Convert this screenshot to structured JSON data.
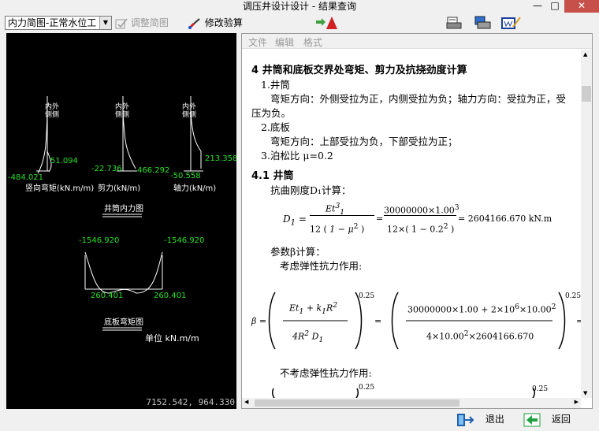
{
  "window": {
    "title": "调压井设计设计 - 结果查询",
    "min": "—",
    "max": "□",
    "close": "✕"
  },
  "toolbar": {
    "combo_value": "内力简图-正常水位工",
    "adjust_label": "调整简图",
    "modify_label": "修改验算"
  },
  "drawing": {
    "lbl_col1": "内外",
    "lbl_col2": "侧侧",
    "n1": "51.094",
    "n2": "-484.021",
    "n3": "-22.736",
    "n4": "466.292",
    "n5": "-50.558",
    "n6": "213.358",
    "cap1": "竖向弯矩(kN.m/m)",
    "cap2": "剪力(kN/m)",
    "cap3": "轴力(kN/m)",
    "title1": "井筒内力图",
    "b1": "-1546.920",
    "b2": "-1546.920",
    "b3": "260.401",
    "b4": "260.401",
    "title2": "底板弯矩图",
    "unit": "单位 kN.m/m",
    "coords": "7152.542, 964.330"
  },
  "menu": {
    "file": "文件",
    "edit": "编辑",
    "format": "格式"
  },
  "doc": {
    "h4": "4  井筒和底板交界处弯矩、剪力及抗挠劲度计算",
    "i1": "1.井筒",
    "i1a": "弯矩方向：外侧受拉为正，内侧受拉为负；轴力方向：受拉为正，受",
    "i1b": "压为负。",
    "i2": "2.底板",
    "i2a": "弯矩方向：上部受拉为负，下部受拉为正；",
    "i3": "3.泊松比  μ=0.2",
    "h41": "4.1  井筒",
    "stiff": "抗曲刚度D₁计算：",
    "f1": "D",
    "f1sub": "1",
    "f1eq": "=",
    "f1num": "Et",
    "f1num_sup": "3",
    "f1num_sub": "1",
    "f1den": "12",
    "f1den2": "1 − μ",
    "f1den2_sup": "2",
    "f1num2": "30000000×1.00",
    "f1num2_sup": "3",
    "f1den3": "12×",
    "f1den4": "1 − 0.2",
    "f1den4_sup": "2",
    "f1res": "= 2604166.670 kN.m",
    "beta_calc": "参数β计算：",
    "elastic": "考虑弹性抗力作用:",
    "beta": "β =",
    "bnum": "Et",
    "bnum_sub": "1",
    "bnum2": " + k",
    "bnum2_sub": "1",
    "bnum3": "R",
    "bnum3_sup": "2",
    "bden": "4R",
    "bden_sup": "2",
    "bden2": "D",
    "bden2_sub": "1",
    "bexp": "0.25",
    "bnumv": "30000000×1.00 + 2×10",
    "bnumv_sup": "6",
    "bnumv2": "×10.00",
    "bnumv2_sup": "2",
    "bdenv": "4×10.00",
    "bdenv_sup": "2",
    "bdenv2": "×2604166.670",
    "bexp2": "0.25",
    "beq2": "=",
    "no_elastic": "不考虑弹性抗力作用:",
    "bexp3": "0.25",
    "bexp4": "0.25"
  },
  "bottom": {
    "exit": "退出",
    "back": "返回"
  }
}
